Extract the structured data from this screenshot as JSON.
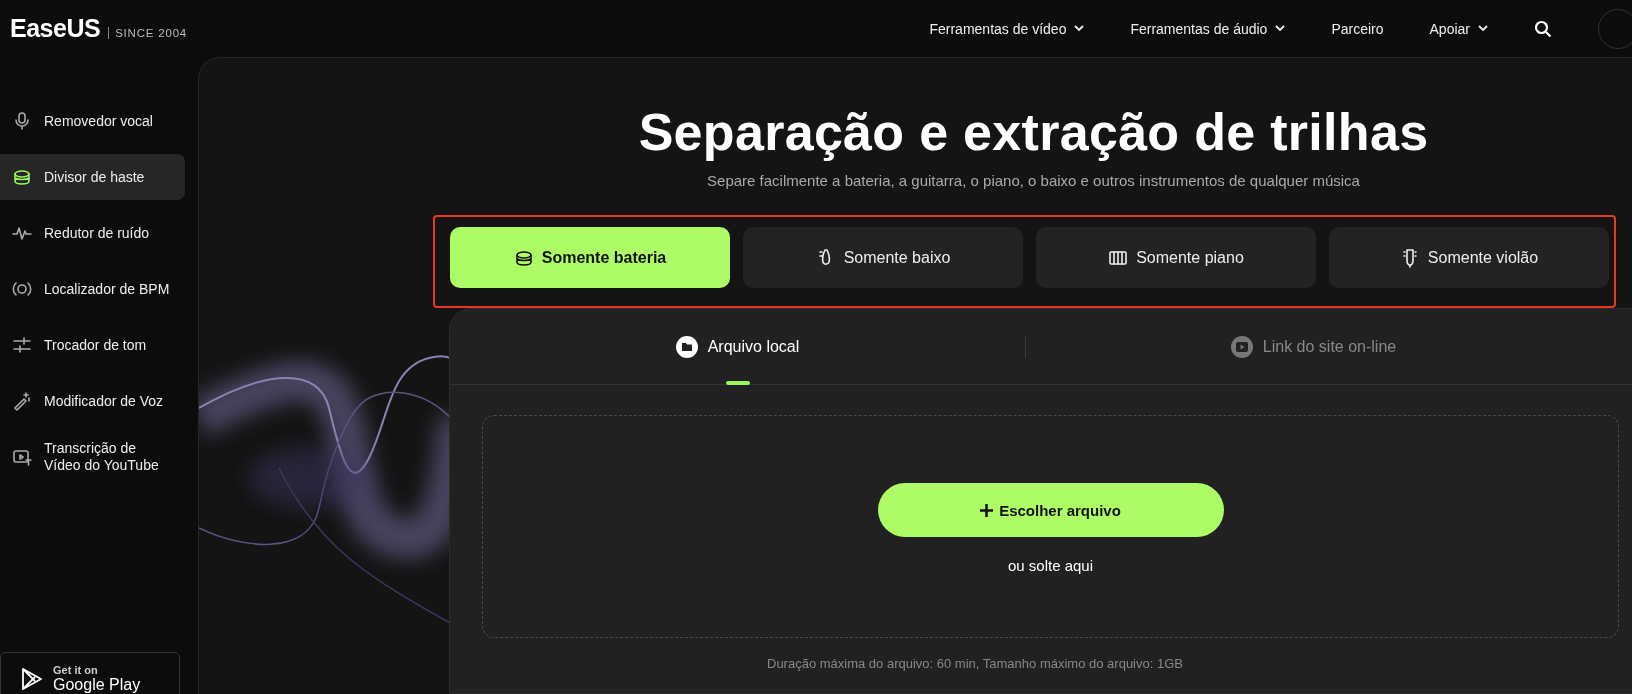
{
  "header": {
    "logo": "EaseUS",
    "tagline": "SINCE 2004",
    "nav": [
      {
        "label": "Ferramentas de vídeo",
        "dropdown": true
      },
      {
        "label": "Ferramentas de áudio",
        "dropdown": true
      },
      {
        "label": "Parceiro",
        "dropdown": false
      },
      {
        "label": "Apoiar",
        "dropdown": true
      }
    ]
  },
  "sidebar": {
    "items": [
      {
        "label": "Removedor vocal",
        "kind": "mic",
        "selected": false
      },
      {
        "label": "Divisor de haste",
        "kind": "drum",
        "selected": true
      },
      {
        "label": "Redutor de ruído",
        "kind": "pulse",
        "selected": false
      },
      {
        "label": "Localizador de BPM",
        "kind": "bpm",
        "selected": false
      },
      {
        "label": "Trocador de tom",
        "kind": "sliders",
        "selected": false
      },
      {
        "label": "Modificador de Voz",
        "kind": "wand",
        "selected": false
      },
      {
        "label": "Transcrição de Vídeo do YouTube",
        "kind": "video",
        "selected": false
      }
    ],
    "store_badge": {
      "line1": "Get it on",
      "line2": "Google Play"
    }
  },
  "hero": {
    "title": "Separação e extração de trilhas",
    "subtitle": "Separe facilmente a bateria, a guitarra, o piano, o baixo e outros instrumentos de qualquer música"
  },
  "modes": [
    {
      "label": "Somente bateria",
      "kind": "drum",
      "selected": true
    },
    {
      "label": "Somente baixo",
      "kind": "bass",
      "selected": false
    },
    {
      "label": "Somente piano",
      "kind": "piano",
      "selected": false
    },
    {
      "label": "Somente violão",
      "kind": "guitar",
      "selected": false
    }
  ],
  "upload": {
    "tabs": [
      {
        "label": "Arquivo local",
        "kind": "folder",
        "selected": true
      },
      {
        "label": "Link do site on-line",
        "kind": "play",
        "selected": false
      }
    ],
    "button": "Escolher arquivo",
    "drop_hint": "ou solte aqui",
    "limits": "Duração máxima do arquivo: 60 min, Tamanho máximo do arquivo: 1GB"
  }
}
